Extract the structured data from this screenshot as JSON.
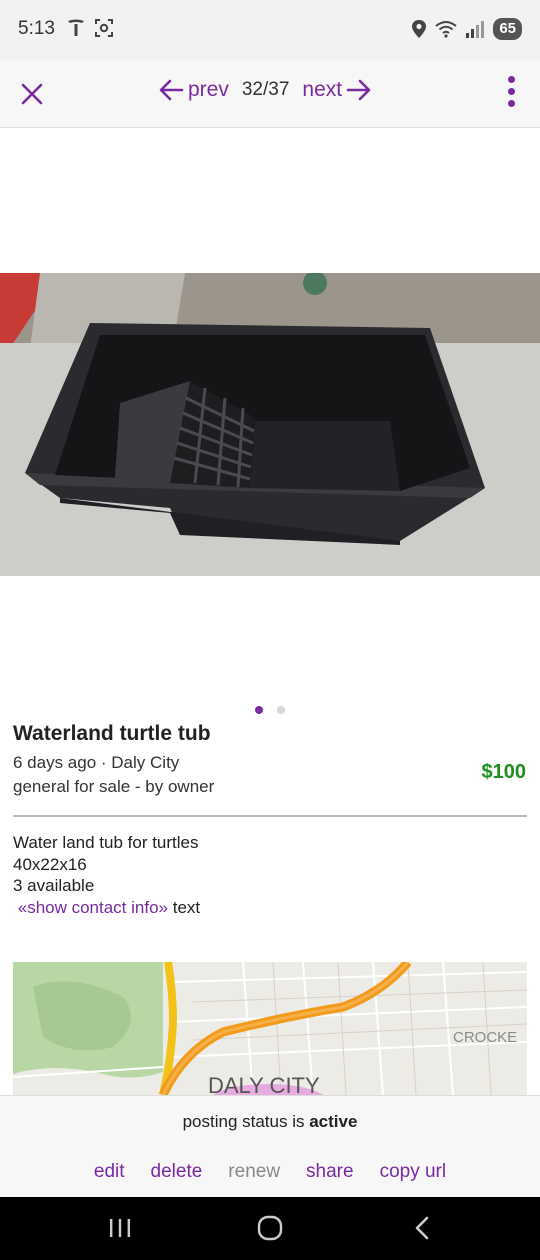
{
  "status_bar": {
    "time": "5:13",
    "battery": "65",
    "icons_left": [
      "tesla-icon",
      "screenshot-icon"
    ],
    "icons_right": [
      "location-icon",
      "wifi-icon",
      "signal-icon",
      "battery-icon"
    ]
  },
  "nav": {
    "prev_label": "prev",
    "next_label": "next",
    "counter": "32/37",
    "accent_color": "#7a2aa0"
  },
  "gallery": {
    "page_count": 2,
    "current_page": 1,
    "photo_subject": "black plastic turtle tub with ramp"
  },
  "listing": {
    "title": "Waterland turtle tub",
    "posted": "6 days ago · Daly City",
    "category": "general for sale - by owner",
    "price": "$100",
    "price_color": "#1d8f1d",
    "description": {
      "line1": "Water land tub for turtles",
      "line2": "40x22x16",
      "line3": "3 available",
      "contact_link": "«show contact info»",
      "contact_suffix": " text"
    }
  },
  "map": {
    "label_city": "DALY CITY",
    "label_area": "CROCKE"
  },
  "action_bar": {
    "status_prefix": "posting status is ",
    "status_value": "active",
    "actions": {
      "edit": "edit",
      "delete": "delete",
      "renew": "renew",
      "share": "share",
      "copy_url": "copy url"
    }
  }
}
